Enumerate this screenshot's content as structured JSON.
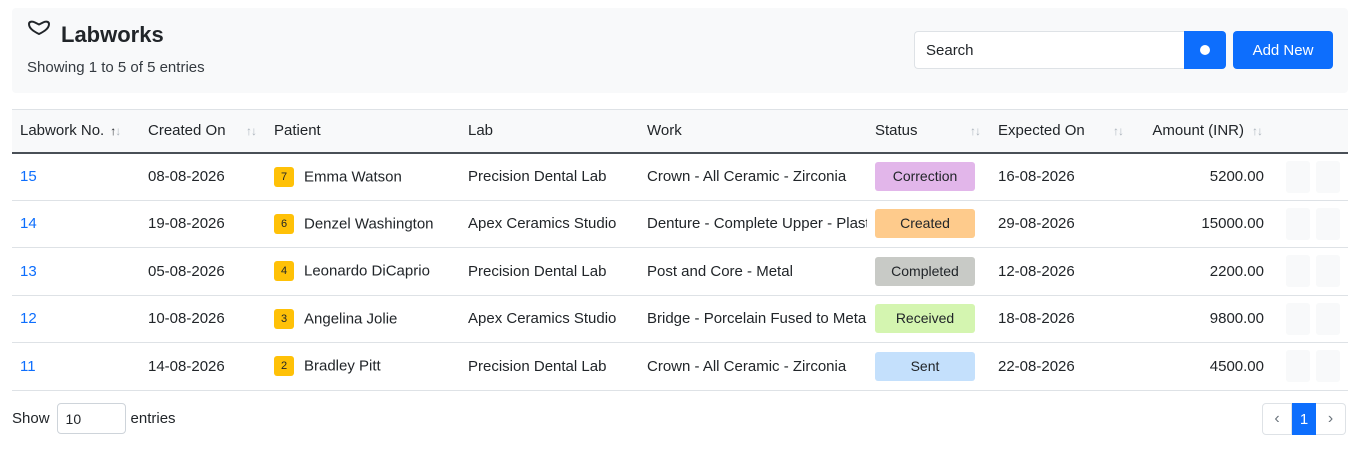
{
  "header": {
    "title": "Labworks",
    "icon": "tooth-icon",
    "subtitle": "Showing 1 to 5 of 5 entries",
    "search_placeholder": "Search",
    "add_label": "Add New",
    "accent": "#0d6efd"
  },
  "columns": {
    "labwork_no": "Labwork No.",
    "created_on": "Created On",
    "patient": "Patient",
    "lab": "Lab",
    "work": "Work",
    "status": "Status",
    "expected_on": "Expected On",
    "amount": "Amount (INR)"
  },
  "rows": [
    {
      "no": "15",
      "created": "08-08-2026",
      "patient_badge": "7",
      "patient": "Emma Watson",
      "lab": "Precision Dental Lab",
      "work": "Crown - All Ceramic - Zirconia",
      "status": "Correction",
      "status_color": "#e2b6ea",
      "expected": "16-08-2026",
      "amount": "5200.00"
    },
    {
      "no": "14",
      "created": "19-08-2026",
      "patient_badge": "6",
      "patient": "Denzel Washington",
      "lab": "Apex Ceramics Studio",
      "work": "Denture - Complete Upper - Plastic",
      "status": "Created",
      "status_color": "#fecb8c",
      "expected": "29-08-2026",
      "amount": "15000.00"
    },
    {
      "no": "13",
      "created": "05-08-2026",
      "patient_badge": "4",
      "patient": "Leonardo DiCaprio",
      "lab": "Precision Dental Lab",
      "work": "Post and Core - Metal",
      "status": "Completed",
      "status_color": "#c8cac6",
      "expected": "12-08-2026",
      "amount": "2200.00"
    },
    {
      "no": "12",
      "created": "10-08-2026",
      "patient_badge": "3",
      "patient": "Angelina Jolie",
      "lab": "Apex Ceramics Studio",
      "work": "Bridge - Porcelain Fused to Metal",
      "status": "Received",
      "status_color": "#d4f5b0",
      "expected": "18-08-2026",
      "amount": "9800.00"
    },
    {
      "no": "11",
      "created": "14-08-2026",
      "patient_badge": "2",
      "patient": "Bradley Pitt",
      "lab": "Precision Dental Lab",
      "work": "Crown - All Ceramic - Zirconia",
      "status": "Sent",
      "status_color": "#c4e0fc",
      "expected": "22-08-2026",
      "amount": "4500.00"
    }
  ],
  "footer": {
    "show_label": "Show",
    "page_size": "10",
    "entries_label": "entries",
    "current_page": "1",
    "prev_icon": "chevron-left-icon",
    "next_icon": "chevron-right-icon"
  }
}
